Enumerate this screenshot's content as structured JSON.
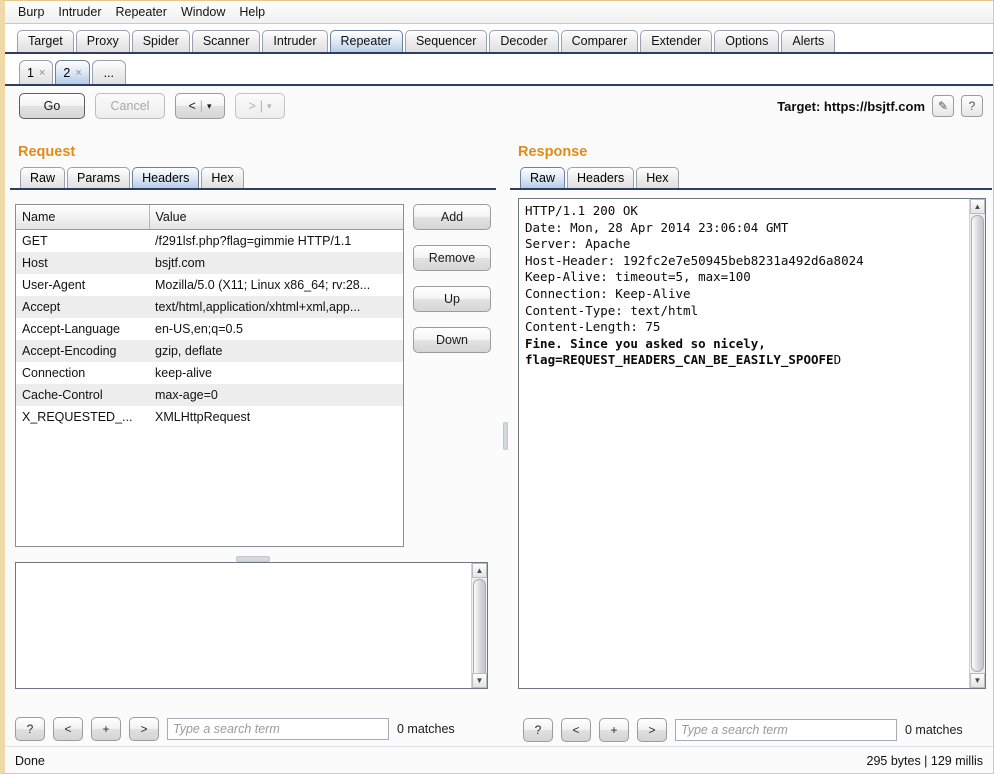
{
  "menubar": [
    "Burp",
    "Intruder",
    "Repeater",
    "Window",
    "Help"
  ],
  "main_tabs": [
    {
      "label": "Target",
      "selected": false
    },
    {
      "label": "Proxy",
      "selected": false
    },
    {
      "label": "Spider",
      "selected": false
    },
    {
      "label": "Scanner",
      "selected": false
    },
    {
      "label": "Intruder",
      "selected": false
    },
    {
      "label": "Repeater",
      "selected": true
    },
    {
      "label": "Sequencer",
      "selected": false
    },
    {
      "label": "Decoder",
      "selected": false
    },
    {
      "label": "Comparer",
      "selected": false
    },
    {
      "label": "Extender",
      "selected": false
    },
    {
      "label": "Options",
      "selected": false
    },
    {
      "label": "Alerts",
      "selected": false
    }
  ],
  "repeater_tabs": [
    {
      "label": "1",
      "close": "×",
      "selected": false
    },
    {
      "label": "2",
      "close": "×",
      "selected": true
    },
    {
      "label": "...",
      "close": "",
      "selected": false
    }
  ],
  "toolbar": {
    "go_label": "Go",
    "cancel_label": "Cancel",
    "back_label": "<",
    "forward_label": ">",
    "caret": "▾",
    "separator": "|",
    "target_label": "Target: https://bsjtf.com",
    "edit_icon": "✎",
    "help_icon": "?"
  },
  "request": {
    "title": "Request",
    "tabs": [
      {
        "label": "Raw",
        "selected": false
      },
      {
        "label": "Params",
        "selected": false
      },
      {
        "label": "Headers",
        "selected": true
      },
      {
        "label": "Hex",
        "selected": false
      }
    ],
    "table": {
      "columns": [
        "Name",
        "Value"
      ],
      "rows": [
        [
          "GET",
          "/f291lsf.php?flag=gimmie HTTP/1.1"
        ],
        [
          "Host",
          "bsjtf.com"
        ],
        [
          "User-Agent",
          "Mozilla/5.0 (X11; Linux x86_64; rv:28..."
        ],
        [
          "Accept",
          "text/html,application/xhtml+xml,app..."
        ],
        [
          "Accept-Language",
          "en-US,en;q=0.5"
        ],
        [
          "Accept-Encoding",
          "gzip, deflate"
        ],
        [
          "Connection",
          "keep-alive"
        ],
        [
          "Cache-Control",
          "max-age=0"
        ],
        [
          "X_REQUESTED_...",
          "XMLHttpRequest"
        ]
      ]
    },
    "buttons": [
      "Add",
      "Remove",
      "Up",
      "Down"
    ],
    "body_text": ""
  },
  "response": {
    "title": "Response",
    "tabs": [
      {
        "label": "Raw",
        "selected": true
      },
      {
        "label": "Headers",
        "selected": false
      },
      {
        "label": "Hex",
        "selected": false
      }
    ],
    "head_text": "HTTP/1.1 200 OK\nDate: Mon, 28 Apr 2014 23:06:04 GMT\nServer: Apache\nHost-Header: 192fc2e7e50945beb8231a492d6a8024\nKeep-Alive: timeout=5, max=100\nConnection: Keep-Alive\nContent-Type: text/html\nContent-Length: 75\n",
    "body_bold": "Fine. Since you asked so nicely,\nflag=REQUEST_HEADERS_CAN_BE_EASILY_SPOOFE",
    "body_tail": "D"
  },
  "search_left": {
    "help_label": "?",
    "prev_label": "<",
    "add_label": "+",
    "next_label": ">",
    "placeholder": "Type a search term",
    "value": "",
    "matches": "0 matches"
  },
  "search_right": {
    "help_label": "?",
    "prev_label": "<",
    "add_label": "+",
    "next_label": ">",
    "placeholder": "Type a search term",
    "value": "",
    "matches": "0 matches"
  },
  "status": {
    "left": "Done",
    "right": "295 bytes | 129 millis"
  },
  "colors": {
    "panel_title": "#e08c1a",
    "tab_selected": "#b9cde8",
    "window_border": "#e8c88a",
    "tabstrip_underline": "#2c3e63"
  }
}
